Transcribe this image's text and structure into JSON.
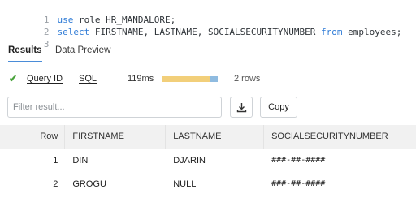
{
  "editor": {
    "lines": [
      {
        "number": "1",
        "parts": [
          {
            "text": "use",
            "kind": "kw"
          },
          {
            "text": " role HR_MANDALORE;",
            "kind": "txt"
          }
        ]
      },
      {
        "number": "2",
        "parts": [
          {
            "text": "select",
            "kind": "kw"
          },
          {
            "text": " FIRSTNAME, LASTNAME, SOCIALSECURITYNUMBER ",
            "kind": "txt"
          },
          {
            "text": "from",
            "kind": "kw"
          },
          {
            "text": " employees;",
            "kind": "txt"
          }
        ]
      },
      {
        "number": "3",
        "parts": []
      }
    ]
  },
  "tabs": [
    {
      "label": "Results",
      "active": true
    },
    {
      "label": "Data Preview",
      "active": false
    }
  ],
  "query_info": {
    "status_icon": "check-icon",
    "status_color": "#49a33b",
    "query_id_label": "Query ID",
    "sql_label": "SQL",
    "duration": "119ms",
    "timing_bar": [
      {
        "fraction": 0.85,
        "color": "#f2cf7a"
      },
      {
        "fraction": 0.15,
        "color": "#8fbbe0"
      }
    ],
    "row_count": "2 rows"
  },
  "filter": {
    "placeholder": "Filter result...",
    "value": ""
  },
  "buttons": {
    "download_icon": "download-icon",
    "copy_label": "Copy"
  },
  "table": {
    "columns": [
      "Row",
      "FIRSTNAME",
      "LASTNAME",
      "SOCIALSECURITYNUMBER"
    ],
    "rows": [
      [
        "1",
        "DIN",
        "DJARIN",
        "###-##-####"
      ],
      [
        "2",
        "GROGU",
        "NULL",
        "###-##-####"
      ]
    ]
  }
}
